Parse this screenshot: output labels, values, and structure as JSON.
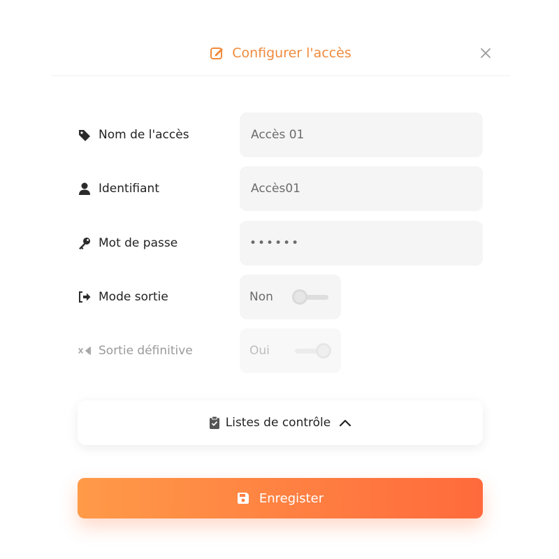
{
  "modal": {
    "title": "Configurer l'accès",
    "accent_color": "#f08a3c",
    "icons": {
      "title": "edit-icon",
      "close": "close-icon"
    }
  },
  "form": {
    "access_name": {
      "label": "Nom de l'accès",
      "value": "Accès 01",
      "icon": "tag-icon"
    },
    "identifier": {
      "label": "Identifiant",
      "value": "Accès01",
      "icon": "user-icon"
    },
    "password": {
      "label": "Mot de passe",
      "value": "••••••",
      "icon": "key-icon"
    },
    "exit_mode": {
      "label": "Mode sortie",
      "state_text": "Non",
      "checked": false,
      "icon": "sign-out-icon"
    },
    "final_exit": {
      "label": "Sortie définitive",
      "state_text": "Oui",
      "checked": true,
      "disabled": true,
      "icon": "backspace-icon"
    }
  },
  "checklists": {
    "label": "Listes de contrôle",
    "icon": "clipboard-check-icon",
    "expanded": true
  },
  "save_button": {
    "label": "Enregister",
    "icon": "save-icon",
    "gradient": [
      "#ff9a48",
      "#ff6a3c"
    ]
  }
}
